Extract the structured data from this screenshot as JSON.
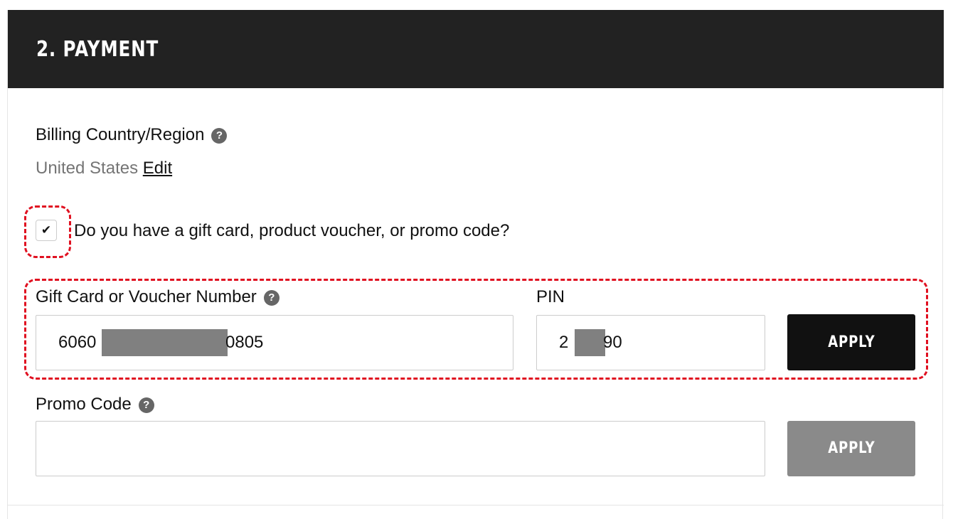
{
  "section": {
    "title": "2. PAYMENT"
  },
  "billing": {
    "label": "Billing Country/Region",
    "help_icon": "question-circle-icon",
    "country": "United States",
    "edit_label": "Edit"
  },
  "gift_option": {
    "checked": true,
    "check_glyph": "✔",
    "label": "Do you have a gift card, product voucher, or promo code?"
  },
  "gift_card": {
    "number_label": "Gift Card or Voucher Number",
    "number_prefix": "6060",
    "number_suffix": "0805",
    "pin_label": "PIN",
    "pin_prefix": "2",
    "pin_suffix": "90",
    "apply_label": "APPLY"
  },
  "promo": {
    "label": "Promo Code",
    "value": "",
    "apply_label": "APPLY"
  },
  "help_glyph": "?",
  "colors": {
    "header_bg": "#222222",
    "highlight": "#e01020",
    "apply_active": "#111111",
    "apply_disabled": "#8a8a8a",
    "mask": "#808080"
  }
}
